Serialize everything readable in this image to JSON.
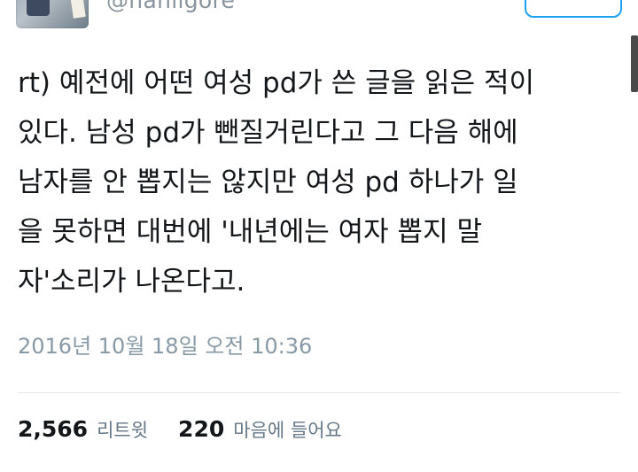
{
  "profile": {
    "handle": "@hanilgore",
    "avatar_icon": "profile-photo"
  },
  "follow_button": {
    "icon": "follow-icon",
    "color": "#1da1f2"
  },
  "tweet": {
    "lines": [
      "rt) 예전에 어떤 여성 pd가 쓴 글을 읽은 적이",
      "있다. 남성 pd가 뺀질거린다고 그 다음 해에",
      "남자를 안 뽑지는 않지만 여성 pd 하나가 일",
      "을 못하면 대번에 '내년에는 여자 뽑지 말",
      "자'소리가 나온다고."
    ],
    "timestamp": "2016년 10월 18일 오전 10:36"
  },
  "stats": {
    "retweets": {
      "count": "2,566",
      "label": "리트윗"
    },
    "likes": {
      "count": "220",
      "label": "마음에 들어요"
    }
  }
}
